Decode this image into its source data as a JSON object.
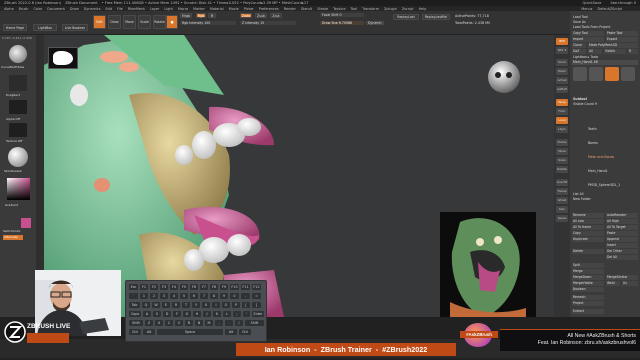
{
  "titlebar": {
    "title": "ZBrush 2022.0.6 (Ian Robinson)",
    "document": "ZBrush Document",
    "mem": "• Free Mem 111.406GB • Active Mem 2492 • Scratch Disk 41 • Timer▸0.052 • PolyCount▸2.39 MP • MeshCount▸17",
    "right": [
      "QuickSave",
      "See-through 0",
      "Menus",
      "DefaultZScript"
    ]
  },
  "menubar": {
    "items": [
      "Alpha",
      "Brush",
      "Color",
      "Document",
      "Draw",
      "Dynamics",
      "Edit",
      "File",
      "FiberMesh",
      "Layer",
      "Light",
      "Macro",
      "Marker",
      "Material",
      "Movie",
      "Picker",
      "Preferences",
      "Render",
      "Stencil",
      "Stroke",
      "Texture",
      "Tool",
      "Transform",
      "Zplugin",
      "Zscript",
      "Help"
    ],
    "right": [
      "Menus",
      "DefaultZScript"
    ],
    "coords": "0.207,-0.491,-0.958"
  },
  "topshelf": {
    "home_page": "Home Page",
    "lightbox": "LightBox",
    "live_boolean": "Live Boolean",
    "edit": "Edit",
    "draw": "Draw",
    "move": "Move",
    "scale": "Scale",
    "rotate": "Rotate",
    "mrgb": "Mrgb",
    "rgb": "Rgb",
    "m": "M",
    "zadd": "Zadd",
    "zsub": "Zsub",
    "zcut": "Zcut",
    "rgb_intensity": "Rgb Intensity 100",
    "z_intensity": "Z Intensity 15",
    "focal_shift": "Focal Shift 0",
    "draw_size": "Draw Size 6.70566",
    "dynamic": "Dynamic",
    "active_points": "ActivePoints: 77,718",
    "total_points": "TotalPoints: 2.438 Mil",
    "replay_last": "ReplayLast",
    "replay_last_rel": "ReplayLastRel"
  },
  "lefttray": {
    "brush_label": "CurveMultiTube",
    "stroke_label": "DragRect",
    "alpha_label": "Alpha Off",
    "texture_label": "Texture Off",
    "material_label": "SkinShade4",
    "gradient_label": "Gradient",
    "switch_color": "SwitchColor",
    "alternate": "Alternate"
  },
  "rightpanel": {
    "items_top": [
      "Load Tool",
      "Save As",
      "Load Tools From Project",
      "Copy Tool",
      "Paste Tool",
      "Import",
      "Export",
      "Clone",
      "Make PolyMesh3D",
      "GoZ",
      "All",
      "Visible",
      "R",
      "Lightbox ▸ Tools",
      "Main_Hand1 48"
    ],
    "subtool": "Subtool",
    "visible_count": "Visible Count 9",
    "subtool_items": [
      "Teeth",
      "Bones",
      "Mesh and Bones",
      "Main_Hand1",
      "PM3D_Sphere3D1_1"
    ],
    "list_all": "List All",
    "new_folder": "New Folder",
    "buttons_lower": [
      "Rename",
      "AutoReorder",
      "All Low",
      "All High",
      "All To Home",
      "All To Target",
      "Copy",
      "Paste",
      "Duplicate",
      "Append",
      "Insert",
      "Delete",
      "Del Other",
      "Del All",
      "Split",
      "Merge",
      "MergeDown",
      "MergeSimilar",
      "MergeVisible",
      "Weld",
      "Uv",
      "Boolean",
      "Remesh",
      "Project",
      "Extract"
    ]
  },
  "rightshelf": [
    "BPR",
    "SPix 3",
    "Scroll",
    "Zoom",
    "Actual",
    "AAHalf",
    "Persp",
    "Floor",
    "Local",
    "LSym",
    "Frame",
    "Move",
    "Scale",
    "Rotate",
    "Line Fill",
    "Transp",
    "Ghost",
    "Solo",
    "Xpose"
  ],
  "keyboard": {
    "rows": [
      [
        "Esc",
        "F1",
        "F2",
        "F3",
        "F4",
        "F5",
        "F6",
        "F7",
        "F8",
        "F9",
        "F10",
        "F11",
        "F12"
      ],
      [
        "`",
        "1",
        "2",
        "3",
        "4",
        "5",
        "6",
        "7",
        "8",
        "9",
        "0",
        "-",
        "="
      ],
      [
        "Tab",
        "Q",
        "W",
        "E",
        "R",
        "T",
        "Y",
        "U",
        "I",
        "O",
        "P",
        "[",
        "]"
      ],
      [
        "Caps",
        "A",
        "S",
        "D",
        "F",
        "G",
        "H",
        "J",
        "K",
        "L",
        ";",
        "'",
        "Enter"
      ],
      [
        "Shift",
        "Z",
        "X",
        "C",
        "V",
        "B",
        "N",
        "M",
        ",",
        ".",
        "/",
        "Shift"
      ],
      [
        "Ctrl",
        "Alt",
        "Space",
        "Alt",
        "Ctrl"
      ]
    ]
  },
  "branding": {
    "zbrush_live": "ZBRUSH LIVE",
    "presenter": "Ian Robinson",
    "sep1": "-",
    "role": "ZBrush Trainer",
    "sep2": "-",
    "hashtag": "#ZBrush2022",
    "askzbrush": "#AskZBrush",
    "news_line1": "All New #AskZBrush & Shorts",
    "news_line2": "Feat. Ian Robinson: zbru.sh/askzbrushvol6"
  },
  "colors": {
    "accent": "#d9762b",
    "banner": "#c04a16",
    "model_green": "#79c79a",
    "tongue_pink": "#c9508e",
    "teeth": "#f2f2ee",
    "bone": "#c9b57a"
  }
}
